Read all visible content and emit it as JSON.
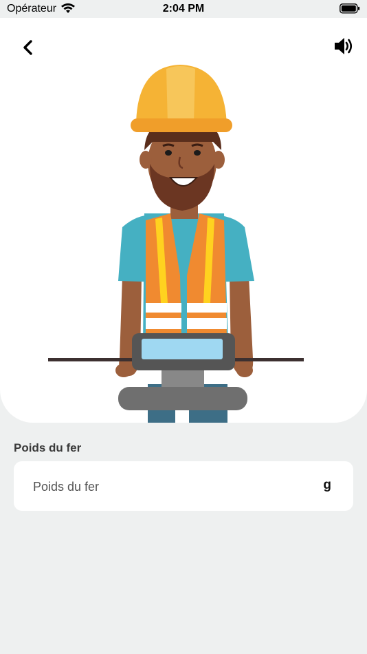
{
  "status_bar": {
    "carrier": "Opérateur",
    "time": "2:04 PM",
    "wifi_icon": "wifi-icon",
    "battery_icon": "battery-icon"
  },
  "header": {
    "back_icon": "chevron-left-icon",
    "sound_icon": "speaker-icon"
  },
  "illustration": {
    "name": "worker-with-scale-illustration"
  },
  "form": {
    "label": "Poids du fer",
    "placeholder": "Poids du fer",
    "value": "",
    "unit": "g"
  },
  "colors": {
    "background": "#eef0f0",
    "card": "#ffffff",
    "helmet": "#f5b335",
    "vest": "#f08a30",
    "shirt": "#45b0c2"
  }
}
